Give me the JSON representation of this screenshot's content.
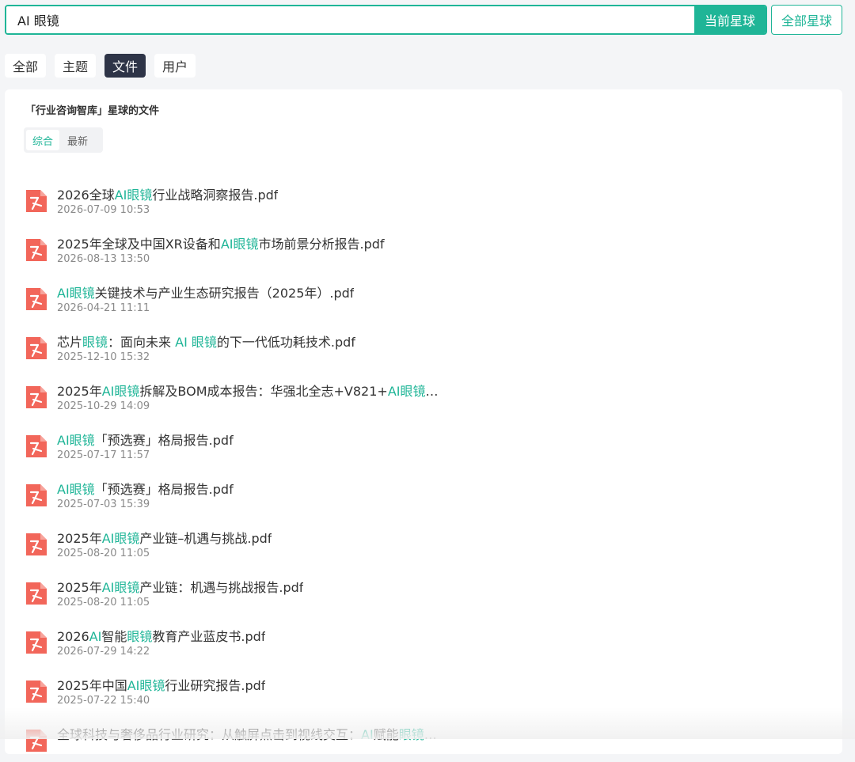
{
  "search": {
    "value": "AI 眼镜",
    "current_btn": "当前星球",
    "all_btn": "全部星球"
  },
  "tabs": [
    {
      "label": "全部",
      "active": false
    },
    {
      "label": "主题",
      "active": false
    },
    {
      "label": "文件",
      "active": true
    },
    {
      "label": "用户",
      "active": false
    }
  ],
  "panel": {
    "title": "「行业咨询智库」星球的文件",
    "sort": [
      {
        "label": "综合",
        "active": true
      },
      {
        "label": "最新",
        "active": false
      }
    ]
  },
  "accent_color": "#1fb597",
  "files": [
    {
      "name": [
        [
          "2026全球",
          0
        ],
        [
          "AI眼镜",
          1
        ],
        [
          "行业战略洞察报告.pdf",
          0
        ]
      ],
      "date": "2026-07-09 10:53"
    },
    {
      "name": [
        [
          "2025年全球及中国XR设备和",
          0
        ],
        [
          "AI眼镜",
          1
        ],
        [
          "市场前景分析报告.pdf",
          0
        ]
      ],
      "date": "2026-08-13 13:50"
    },
    {
      "name": [
        [
          "AI眼镜",
          1
        ],
        [
          "关键技术与产业生态研究报告（2025年）.pdf",
          0
        ]
      ],
      "date": "2026-04-21 11:11"
    },
    {
      "name": [
        [
          "芯片",
          0
        ],
        [
          "眼镜",
          1
        ],
        [
          "：面向未来 ",
          0
        ],
        [
          "AI 眼镜",
          1
        ],
        [
          "的下一代低功耗技术.pdf",
          0
        ]
      ],
      "date": "2025-12-10 15:32"
    },
    {
      "name": [
        [
          "2025年",
          0
        ],
        [
          "AI眼镜",
          1
        ],
        [
          "拆解及BOM成本报告：华强北全志+V821+",
          0
        ],
        [
          "AI眼镜",
          1
        ],
        [
          "…",
          0
        ]
      ],
      "date": "2025-10-29 14:09"
    },
    {
      "name": [
        [
          "AI眼镜",
          1
        ],
        [
          "「预选赛」格局报告.pdf",
          0
        ]
      ],
      "date": "2025-07-17 11:57"
    },
    {
      "name": [
        [
          "AI眼镜",
          1
        ],
        [
          "「预选赛」格局报告.pdf",
          0
        ]
      ],
      "date": "2025-07-03 15:39"
    },
    {
      "name": [
        [
          "2025年",
          0
        ],
        [
          "AI眼镜",
          1
        ],
        [
          "产业链–机遇与挑战.pdf",
          0
        ]
      ],
      "date": "2025-08-20 11:05"
    },
    {
      "name": [
        [
          "2025年",
          0
        ],
        [
          "AI眼镜",
          1
        ],
        [
          "产业链：机遇与挑战报告.pdf",
          0
        ]
      ],
      "date": "2025-08-20 11:05"
    },
    {
      "name": [
        [
          "2026",
          0
        ],
        [
          "AI",
          1
        ],
        [
          "智能",
          0
        ],
        [
          "眼镜",
          1
        ],
        [
          "教育产业蓝皮书.pdf",
          0
        ]
      ],
      "date": "2026-07-29 14:22"
    },
    {
      "name": [
        [
          "2025年中国",
          0
        ],
        [
          "AI眼镜",
          1
        ],
        [
          "行业研究报告.pdf",
          0
        ]
      ],
      "date": "2025-07-22 15:40"
    },
    {
      "name": [
        [
          "全球科技与奢侈品行业研究：从触屏点击到视线交互：",
          0
        ],
        [
          "AI",
          1
        ],
        [
          "赋能",
          0
        ],
        [
          "眼镜",
          1
        ],
        [
          "…",
          0
        ]
      ],
      "date": ""
    }
  ]
}
